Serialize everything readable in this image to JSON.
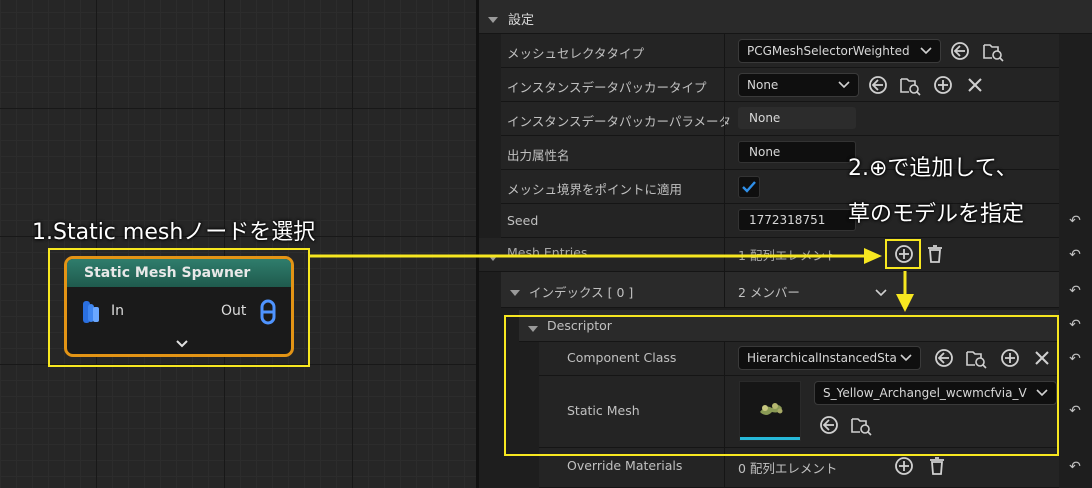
{
  "graph": {
    "node": {
      "title": "Static Mesh Spawner",
      "in_label": "In",
      "out_label": "Out"
    }
  },
  "panel": {
    "section_title": "設定",
    "rows": {
      "mesh_selector_type": {
        "label": "メッシュセレクタタイプ",
        "value": "PCGMeshSelectorWeighted"
      },
      "instance_packer_type": {
        "label": "インスタンスデータパッカータイプ",
        "value": "None"
      },
      "instance_packer_params": {
        "label": "インスタンスデータパッカーパラメータ",
        "value": "None"
      },
      "out_attribute_name": {
        "label": "出力属性名",
        "value": "None"
      },
      "apply_mesh_bounds": {
        "label": "メッシュ境界をポイントに適用",
        "checked": true
      },
      "seed": {
        "label": "Seed",
        "value": "1772318751"
      },
      "mesh_entries": {
        "label": "Mesh Entries",
        "value": "1 配列エレメント"
      },
      "index0": {
        "label": "インデックス [ 0 ]",
        "value": "2 メンバー"
      },
      "descriptor": {
        "label": "Descriptor"
      },
      "component_class": {
        "label": "Component Class",
        "value": "HierarchicalInstancedSta"
      },
      "static_mesh": {
        "label": "Static Mesh",
        "value": "S_Yellow_Archangel_wcwmcfvia_V"
      },
      "override_materials": {
        "label": "Override Materials",
        "value": "0 配列エレメント"
      }
    }
  },
  "callouts": {
    "step1": "1.Static meshノードを選択",
    "step2_line1": "2.⊕で追加して、",
    "step2_line2": "草のモデルを指定"
  },
  "colors": {
    "highlight": "#f7e720",
    "node_border": "#e39415",
    "node_header": "#2f7d6c",
    "checkbox_tick": "#2f8fe8",
    "thumbnail_bar": "#26b8d8"
  }
}
